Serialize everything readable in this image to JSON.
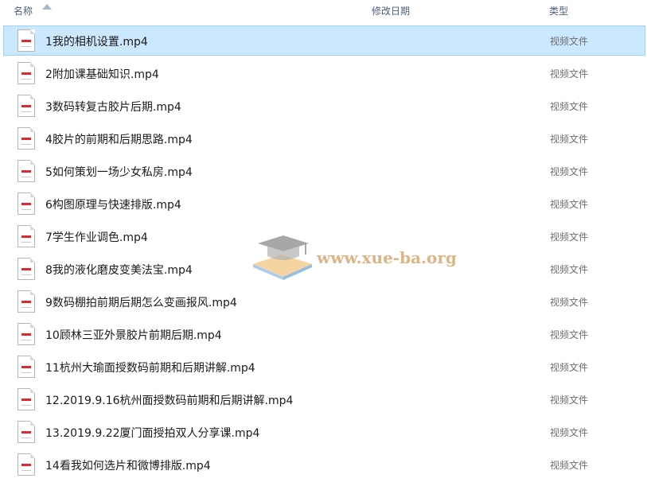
{
  "header": {
    "name_label": "名称",
    "date_label": "修改日期",
    "type_label": "类型"
  },
  "rows": [
    {
      "name": "1我的相机设置.mp4",
      "type": "视频文件",
      "selected": true
    },
    {
      "name": "2附加课基础知识.mp4",
      "type": "视频文件"
    },
    {
      "name": "3数码转复古胶片后期.mp4",
      "type": "视频文件"
    },
    {
      "name": "4胶片的前期和后期思路.mp4",
      "type": "视频文件"
    },
    {
      "name": "5如何策划一场少女私房.mp4",
      "type": "视频文件"
    },
    {
      "name": "6构图原理与快速排版.mp4",
      "type": "视频文件"
    },
    {
      "name": "7学生作业调色.mp4",
      "type": "视频文件"
    },
    {
      "name": "8我的液化磨皮变美法宝.mp4",
      "type": "视频文件"
    },
    {
      "name": "9数码棚拍前期后期怎么变画报风.mp4",
      "type": "视频文件"
    },
    {
      "name": "10顾林三亚外景胶片前期后期.mp4",
      "type": "视频文件"
    },
    {
      "name": "11杭州大瑜面授数码前期和后期讲解.mp4",
      "type": "视频文件"
    },
    {
      "name": "12.2019.9.16杭州面授数码前期和后期讲解.mp4",
      "type": "视频文件"
    },
    {
      "name": "13.2019.9.22厦门面授拍双人分享课.mp4",
      "type": "视频文件"
    },
    {
      "name": "14看我如何选片和微博排版.mp4",
      "type": "视频文件"
    }
  ],
  "watermark": {
    "text": "www.xue-ba.org",
    "icon": "graduation-cap-book-icon"
  },
  "colors": {
    "selection_bg": "#cce8ff",
    "selection_border": "#99d1ff",
    "file_icon_accent": "#e0262f"
  }
}
